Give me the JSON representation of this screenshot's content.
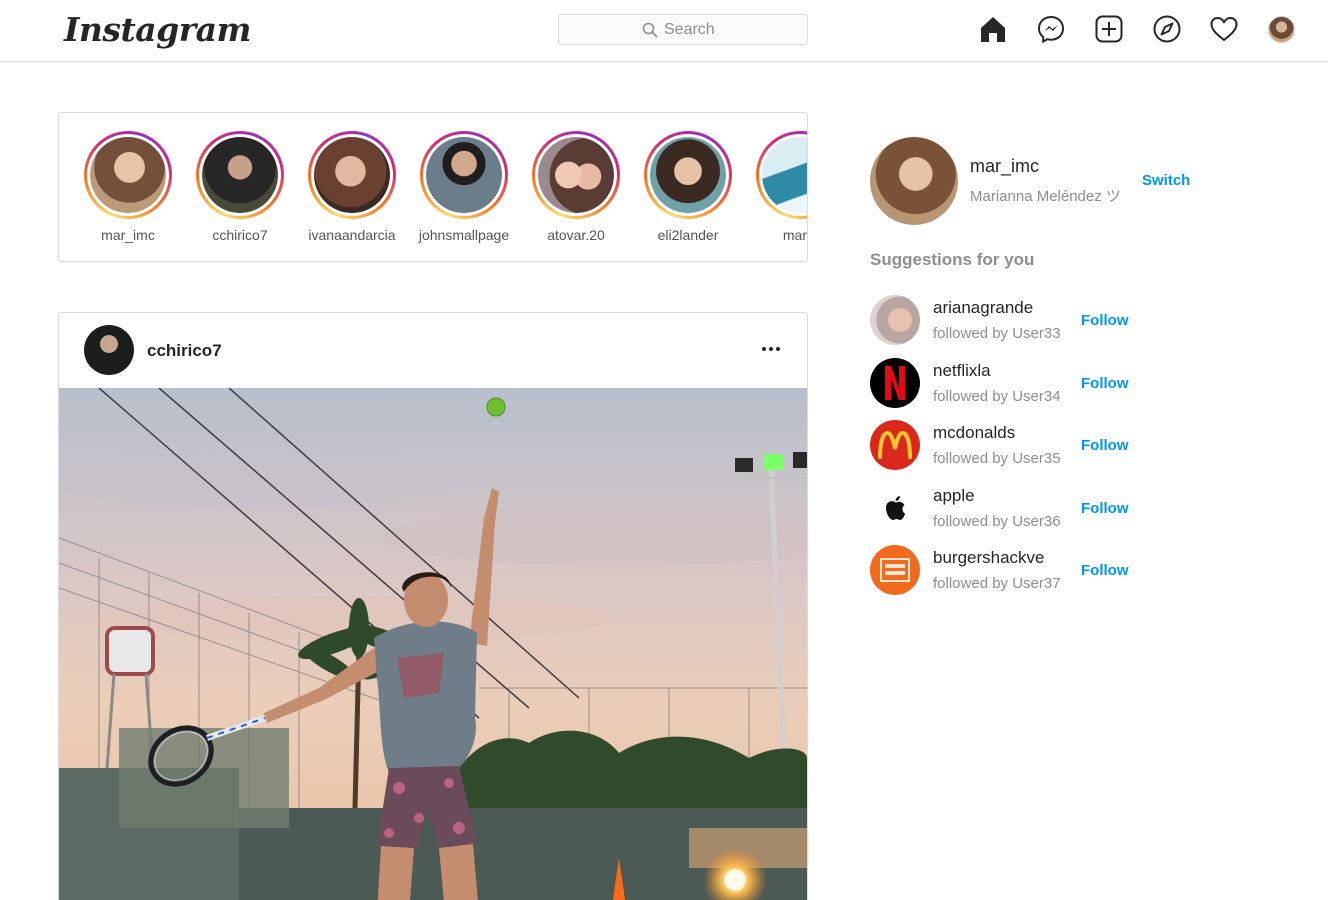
{
  "header": {
    "logo": "Instagram",
    "search_placeholder": "Search",
    "icons": [
      "home-icon",
      "messenger-icon",
      "new-post-icon",
      "explore-icon",
      "activity-heart-icon",
      "profile-avatar"
    ]
  },
  "stories": [
    {
      "name": "mar_imc"
    },
    {
      "name": "cchirico7"
    },
    {
      "name": "ivanaandarcia"
    },
    {
      "name": "johnsmallpage"
    },
    {
      "name": "atovar.20"
    },
    {
      "name": "eli2lander"
    },
    {
      "name": "mariv"
    }
  ],
  "post": {
    "username": "cchirico7"
  },
  "sidebar": {
    "username": "mar_imc",
    "full_name": "Marianna Meléndez ツ",
    "switch_label": "Switch",
    "suggestions_title": "Suggestions for you",
    "follow_label": "Follow",
    "suggestions": [
      {
        "username": "arianagrande",
        "followed_by": "followed by User33"
      },
      {
        "username": "netflixla",
        "followed_by": "followed by User34"
      },
      {
        "username": "mcdonalds",
        "followed_by": "followed by User35"
      },
      {
        "username": "apple",
        "followed_by": "followed by User36"
      },
      {
        "username": "burgershackve",
        "followed_by": "followed by User37"
      }
    ]
  },
  "colors": {
    "accent": "#0095f6",
    "text": "#262626",
    "muted": "#8e8e8e",
    "border": "#dbdbdb",
    "netflix_red": "#e50914",
    "mcdonalds_red": "#da291c",
    "mcdonalds_yellow": "#ffc72c",
    "burgershack_orange": "#f26a1b"
  }
}
